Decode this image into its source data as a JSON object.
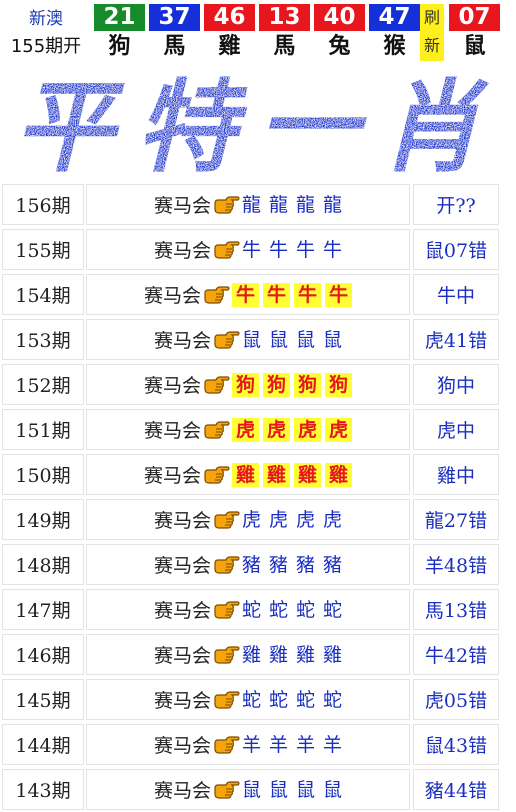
{
  "header": {
    "brand": "新澳",
    "period": "155期开",
    "refresh_label": "刷新",
    "balls": [
      {
        "number": "21",
        "zodiac": "狗",
        "color": "green"
      },
      {
        "number": "37",
        "zodiac": "馬",
        "color": "blue"
      },
      {
        "number": "46",
        "zodiac": "雞",
        "color": "red"
      },
      {
        "number": "13",
        "zodiac": "馬",
        "color": "red"
      },
      {
        "number": "40",
        "zodiac": "兔",
        "color": "red"
      },
      {
        "number": "47",
        "zodiac": "猴",
        "color": "blue"
      },
      {
        "number": "07",
        "zodiac": "鼠",
        "color": "red"
      }
    ]
  },
  "banner": {
    "text": "平特一肖",
    "color": "#1f3cd6"
  },
  "history": {
    "rows": [
      {
        "period": "156期",
        "site": "赛马会",
        "picks": [
          "龍",
          "龍",
          "龍",
          "龍"
        ],
        "result": "开??",
        "hit": false
      },
      {
        "period": "155期",
        "site": "赛马会",
        "picks": [
          "牛",
          "牛",
          "牛",
          "牛"
        ],
        "result": "鼠07错",
        "hit": false
      },
      {
        "period": "154期",
        "site": "赛马会",
        "picks": [
          "牛",
          "牛",
          "牛",
          "牛"
        ],
        "result": "牛中",
        "hit": true
      },
      {
        "period": "153期",
        "site": "赛马会",
        "picks": [
          "鼠",
          "鼠",
          "鼠",
          "鼠"
        ],
        "result": "虎41错",
        "hit": false
      },
      {
        "period": "152期",
        "site": "赛马会",
        "picks": [
          "狗",
          "狗",
          "狗",
          "狗"
        ],
        "result": "狗中",
        "hit": true
      },
      {
        "period": "151期",
        "site": "赛马会",
        "picks": [
          "虎",
          "虎",
          "虎",
          "虎"
        ],
        "result": "虎中",
        "hit": true
      },
      {
        "period": "150期",
        "site": "赛马会",
        "picks": [
          "雞",
          "雞",
          "雞",
          "雞"
        ],
        "result": "雞中",
        "hit": true
      },
      {
        "period": "149期",
        "site": "赛马会",
        "picks": [
          "虎",
          "虎",
          "虎",
          "虎"
        ],
        "result": "龍27错",
        "hit": false
      },
      {
        "period": "148期",
        "site": "赛马会",
        "picks": [
          "豬",
          "豬",
          "豬",
          "豬"
        ],
        "result": "羊48错",
        "hit": false
      },
      {
        "period": "147期",
        "site": "赛马会",
        "picks": [
          "蛇",
          "蛇",
          "蛇",
          "蛇"
        ],
        "result": "馬13错",
        "hit": false
      },
      {
        "period": "146期",
        "site": "赛马会",
        "picks": [
          "雞",
          "雞",
          "雞",
          "雞"
        ],
        "result": "牛42错",
        "hit": false
      },
      {
        "period": "145期",
        "site": "赛马会",
        "picks": [
          "蛇",
          "蛇",
          "蛇",
          "蛇"
        ],
        "result": "虎05错",
        "hit": false
      },
      {
        "period": "144期",
        "site": "赛马会",
        "picks": [
          "羊",
          "羊",
          "羊",
          "羊"
        ],
        "result": "鼠43错",
        "hit": false
      },
      {
        "period": "143期",
        "site": "赛马会",
        "picks": [
          "鼠",
          "鼠",
          "鼠",
          "鼠"
        ],
        "result": "豬44错",
        "hit": false
      }
    ]
  }
}
